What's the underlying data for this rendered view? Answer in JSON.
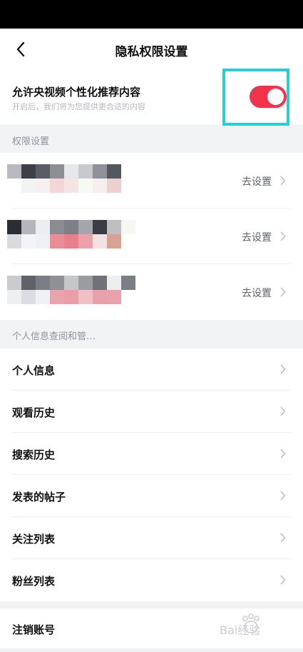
{
  "header": {
    "title": "隐私权限设置"
  },
  "recommend": {
    "title": "允许央视频个性化推荐内容",
    "subtitle": "开启后，我们将为您提供更合适的内容",
    "toggle_on": true
  },
  "permissions": {
    "section_label": "权限设置",
    "action_label": "去设置",
    "rows": [
      {
        "mosaic": [
          [
            "#b8babf",
            "#3d3f46",
            "#5a5c63",
            "#8d8f95",
            "#e6e7ea",
            "#c8c9cd",
            "#909198",
            "#55575e",
            "#ffffff",
            "#ffffff"
          ],
          [
            "#ffffff",
            "#f2f3f5",
            "#f7f0f0",
            "#f3d6d7",
            "#f4e4e4",
            "#f8f8f6",
            "#f6efee",
            "#eccfd0",
            "#ffffff",
            "#ffffff"
          ]
        ]
      },
      {
        "mosaic": [
          [
            "#2b2d35",
            "#b4b6bb",
            "#ecedf0",
            "#8b8c92",
            "#7e8088",
            "#a4a6ac",
            "#3a3c44",
            "#bdbfc3",
            "#f6f7f0",
            "#ffffff"
          ],
          [
            "#d9dadd",
            "#f4f4f6",
            "#eef0f2",
            "#e98e97",
            "#e7808c",
            "#eca1a8",
            "#f2e2e2",
            "#d8a193",
            "#ffffff",
            "#ffffff"
          ]
        ]
      },
      {
        "mosaic": [
          [
            "#c9cbce",
            "#60626a",
            "#7b7d84",
            "#8e9096",
            "#c6c7cb",
            "#9b9ca2",
            "#70727a",
            "#eeeef0",
            "#7c7e85",
            "#ffffff"
          ],
          [
            "#eeeff1",
            "#dcdde0",
            "#f0f1f3",
            "#e8a4ac",
            "#e99ea8",
            "#efc0c5",
            "#e8a1aa",
            "#e9a2ab",
            "#ffffff",
            "#ffffff"
          ]
        ]
      }
    ]
  },
  "personal_info": {
    "section_label": "个人信息查阅和管…",
    "items": [
      {
        "label": "个人信息"
      },
      {
        "label": "观看历史"
      },
      {
        "label": "搜索历史"
      },
      {
        "label": "发表的帖子"
      },
      {
        "label": "关注列表"
      },
      {
        "label": "粉丝列表"
      }
    ]
  },
  "account": {
    "cancel_label": "注销账号"
  },
  "colors": {
    "accent": "#f0334a",
    "highlight": "#27d0cf",
    "background": "#f2f3f5",
    "secondary_text": "#8e939b"
  },
  "icons": {
    "back": "chevron-left-icon",
    "row_arrow": "chevron-right-icon"
  },
  "watermark": {
    "text": "Bai经验"
  }
}
